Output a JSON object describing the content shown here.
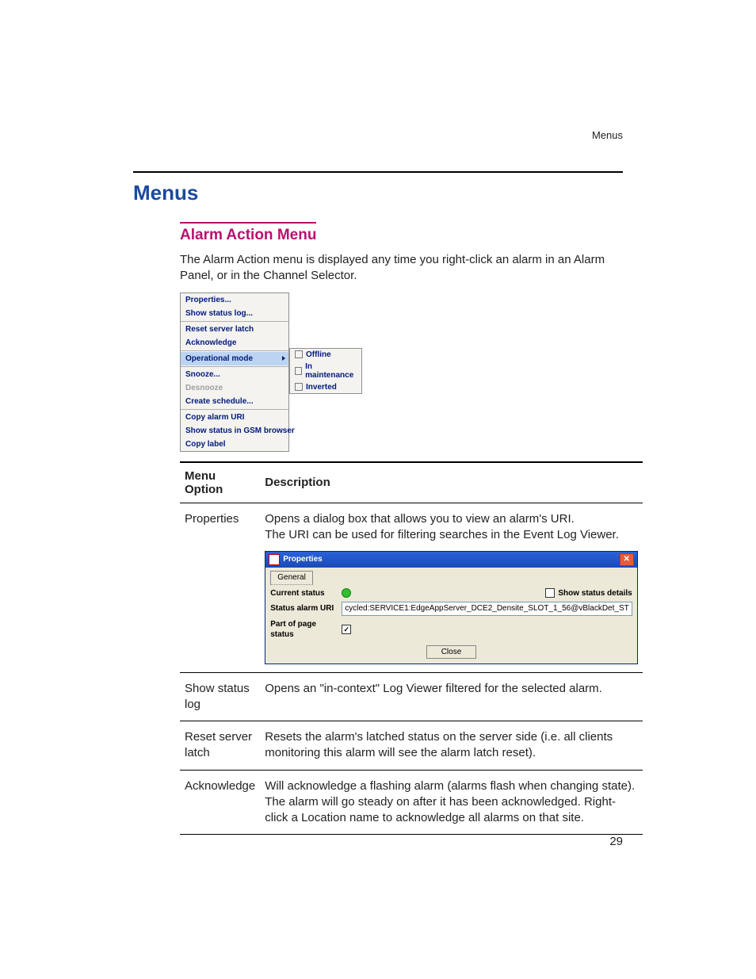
{
  "running_head": "Menus",
  "h1": "Menus",
  "h2": "Alarm Action Menu",
  "intro": "The Alarm Action menu is displayed any time you right-click an alarm in an Alarm Panel, or in the Channel Selector.",
  "context_menu": {
    "items": [
      "Properties...",
      "Show status log...",
      "Reset server latch",
      "Acknowledge",
      "Operational mode",
      "Snooze...",
      "Desnooze",
      "Create schedule...",
      "Copy alarm URI",
      "Show status in GSM browser",
      "Copy label"
    ],
    "highlight_index": 4,
    "disabled_index": 6,
    "separators_after": [
      1,
      3,
      4,
      7
    ],
    "submenu": [
      "Offline",
      "In maintenance",
      "Inverted"
    ]
  },
  "table": {
    "headers": [
      "Menu Option",
      "Description"
    ],
    "rows": [
      {
        "option": "Properties",
        "desc_lines": [
          "Opens a dialog box that allows you to view an alarm's URI.",
          "The URI can be used for filtering searches in the Event Log Viewer."
        ],
        "has_dialog": true
      },
      {
        "option": "Show status log",
        "desc_lines": [
          "Opens an \"in-context\" Log Viewer filtered for the selected alarm."
        ],
        "has_dialog": false
      },
      {
        "option": "Reset server latch",
        "desc_lines": [
          "Resets the alarm's latched status on the server side (i.e. all clients monitoring this alarm will see the alarm latch reset)."
        ],
        "has_dialog": false
      },
      {
        "option": "Acknowledge",
        "desc_lines": [
          "Will acknowledge a flashing alarm (alarms flash when changing state). The alarm will go steady on after it has been acknowledged. Right-click a Location name to acknowledge all alarms on that site."
        ],
        "has_dialog": false
      }
    ]
  },
  "dialog": {
    "title": "Properties",
    "tab": "General",
    "rows": {
      "current_status": "Current status",
      "show_details": "Show status details",
      "uri_label": "Status alarm URI",
      "uri_value": "cycled:SERVICE1:EdgeAppServer_DCE2_Densite_SLOT_1_56@vBlackDet_ST",
      "page_status": "Part of page status"
    },
    "close": "Close"
  },
  "page_number": "29"
}
